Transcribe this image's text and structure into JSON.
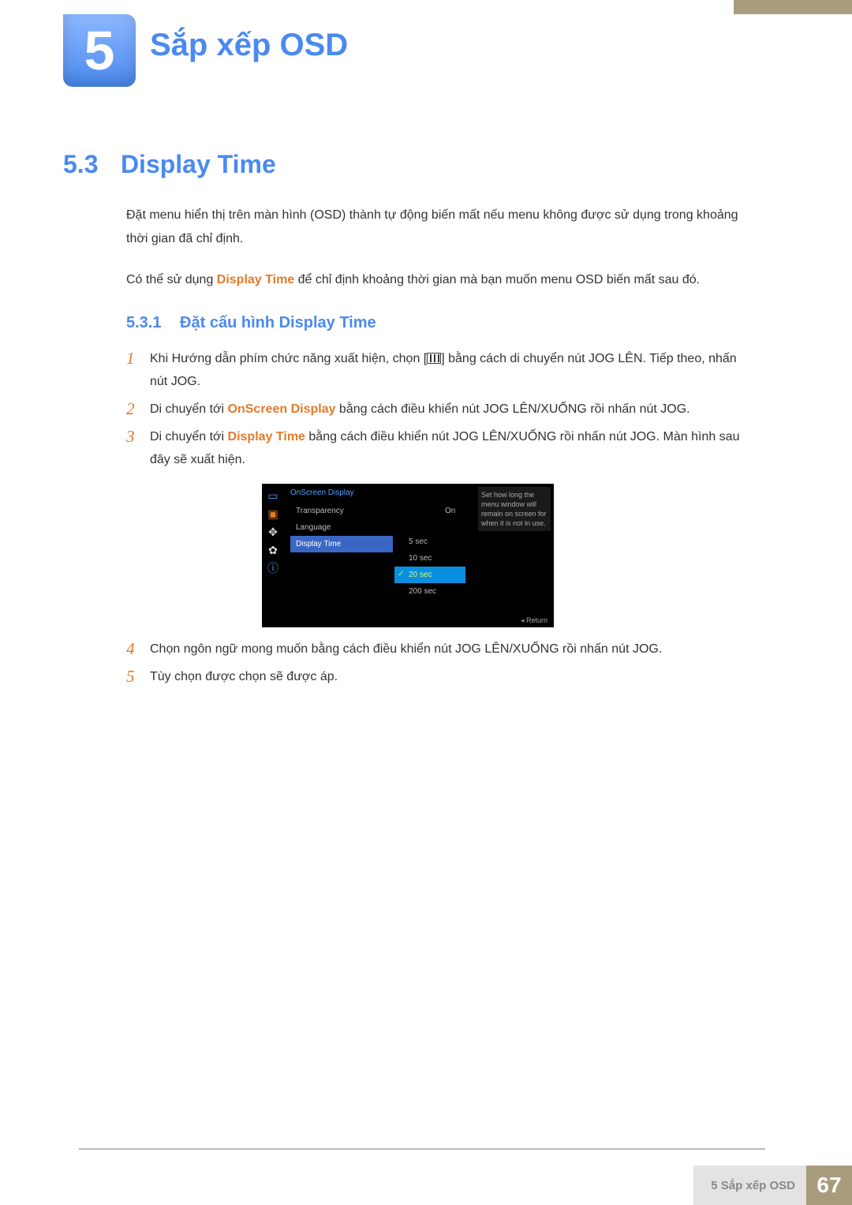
{
  "chapter": {
    "number": "5",
    "title": "Sắp xếp OSD"
  },
  "section": {
    "number": "5.3",
    "title": "Display Time",
    "para1": "Đặt menu hiển thị trên màn hình (OSD) thành tự động biến mất nếu menu không được sử dụng trong khoảng thời gian đã chỉ định.",
    "para2a": "Có thể sử dụng ",
    "para2b": "Display Time",
    "para2c": " để chỉ định khoảng thời gian mà bạn muốn menu OSD biến mất sau đó."
  },
  "subsection": {
    "number": "5.3.1",
    "title": "Đặt cấu hình Display Time"
  },
  "steps": {
    "s1n": "1",
    "s1a": "Khi Hướng dẫn phím chức năng xuất hiện, chọn [",
    "s1b": "] bằng cách di chuyển nút JOG LÊN. Tiếp theo, nhấn nút JOG.",
    "s2n": "2",
    "s2a": "Di chuyển tới ",
    "s2b": "OnScreen Display",
    "s2c": " bằng cách điều khiển nút JOG LÊN/XUỐNG rồi nhấn nút JOG.",
    "s3n": "3",
    "s3a": "Di chuyển tới ",
    "s3b": "Display Time",
    "s3c": " bằng cách điều khiển nút JOG LÊN/XUỐNG rồi nhấn nút JOG. Màn hình sau đây sẽ xuất hiện.",
    "s4n": "4",
    "s4": "Chọn ngôn ngữ mong muốn bằng cách điều khiển nút JOG LÊN/XUỐNG rồi nhấn nút JOG.",
    "s5n": "5",
    "s5": "Tùy chọn được chọn sẽ được áp."
  },
  "osd": {
    "header": "OnScreen Display",
    "menu": {
      "transparency": "Transparency",
      "language": "Language",
      "display_time": "Display Time"
    },
    "value_on": "On",
    "options": {
      "o1": "5 sec",
      "o2": "10 sec",
      "o3": "20 sec",
      "o4": "200 sec"
    },
    "help": "Set how long the menu window will remain on screen for when it is not in use.",
    "return": "Return"
  },
  "footer": {
    "label": "5 Sắp xếp OSD",
    "page": "67"
  }
}
